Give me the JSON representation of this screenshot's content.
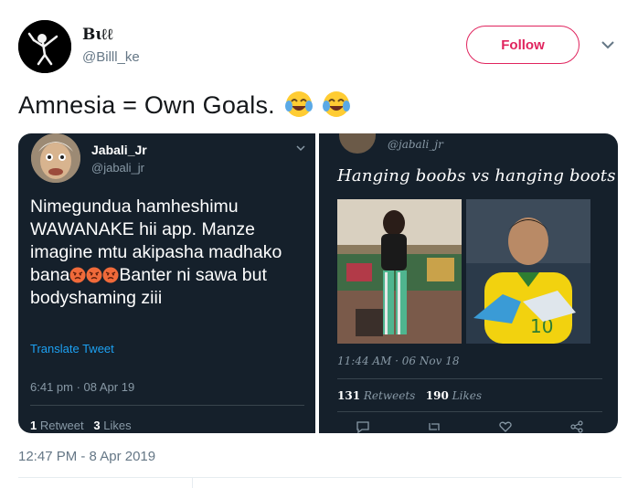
{
  "author": {
    "name": "Bɩℓℓ",
    "handle": "@Billl_ke",
    "avatar_icon": "dabbing-skeleton-icon"
  },
  "follow_label": "Follow",
  "accent_color": "#e0245e",
  "tweet": {
    "text": "Amnesia = Own Goals.",
    "emojis": [
      "face-with-tears-of-joy-icon",
      "face-with-tears-of-joy-icon"
    ],
    "timestamp": "12:47 PM - 8 Apr 2019"
  },
  "left_panel": {
    "name": "Jabali_Jr",
    "handle": "@jabali_jr",
    "text_before": "Nimegundua hamheshimu WAWANAKE hii app. Manze imagine mtu akipasha madhako bana",
    "text_after": "Banter ni sawa but bodyshaming ziii",
    "emoji_icon": "angry-face-icon",
    "translate_label": "Translate Tweet",
    "time": "6:41 pm · 08 Apr 19",
    "retweets_count": "1",
    "retweets_label": "Retweet",
    "likes_count": "3",
    "likes_label": "Likes"
  },
  "right_panel": {
    "handle": "@jabali_jr",
    "text": "Hanging boobs vs hanging boots",
    "time": "11:44 AM · 06 Nov 18",
    "retweets_count": "131",
    "retweets_label": "Retweets",
    "likes_count": "190",
    "likes_label": "Likes",
    "action_icons": [
      "reply-icon",
      "retweet-icon",
      "like-icon",
      "share-icon"
    ]
  }
}
